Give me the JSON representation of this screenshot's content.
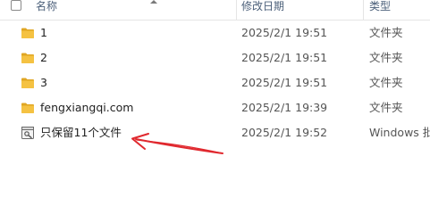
{
  "header": {
    "name_label": "名称",
    "date_label": "修改日期",
    "type_label": "类型"
  },
  "rows": [
    {
      "name": "1",
      "date": "2025/2/1 19:51",
      "type": "文件夹",
      "icon": "folder-icon"
    },
    {
      "name": "2",
      "date": "2025/2/1 19:51",
      "type": "文件夹",
      "icon": "folder-icon"
    },
    {
      "name": "3",
      "date": "2025/2/1 19:51",
      "type": "文件夹",
      "icon": "folder-icon"
    },
    {
      "name": "fengxiangqi.com",
      "date": "2025/2/1 19:39",
      "type": "文件夹",
      "icon": "folder-icon"
    },
    {
      "name": "只保留11个文件",
      "date": "2025/2/1 19:52",
      "type": "Windows 批",
      "icon": "batch-file-icon"
    }
  ],
  "colors": {
    "folder": "#f5c242",
    "folder_dark": "#e0a623",
    "arrow": "#e0282e",
    "header_text": "#4c607a"
  },
  "annotation": {
    "icon": "red-arrow"
  }
}
